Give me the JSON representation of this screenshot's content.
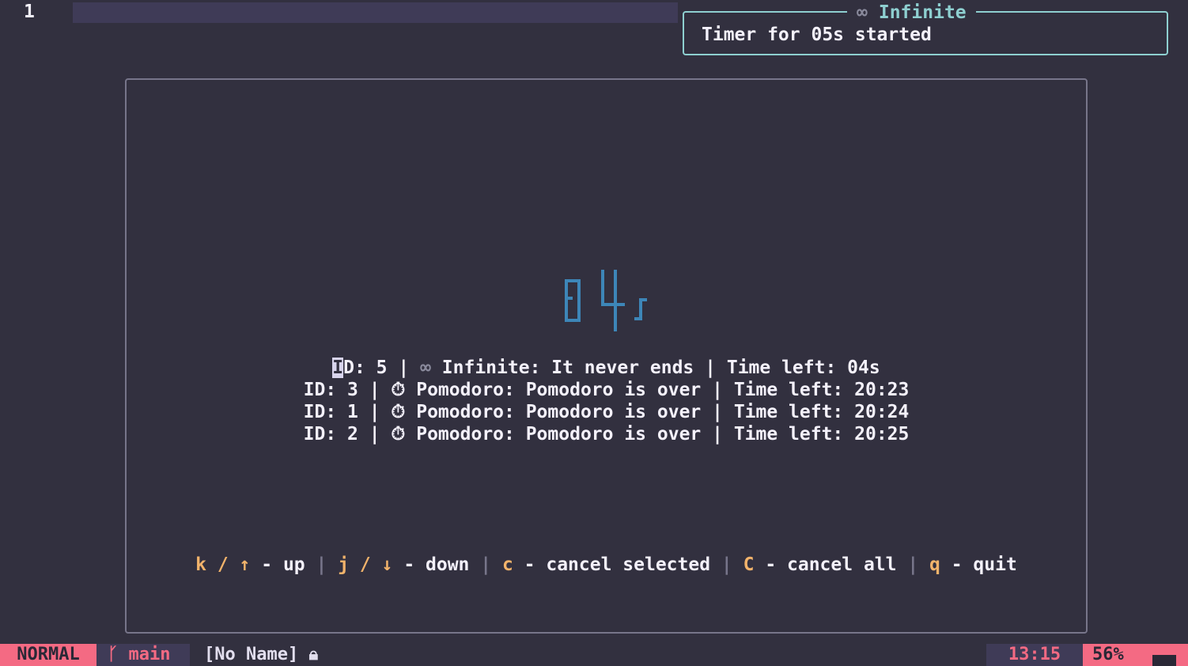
{
  "editor": {
    "line_number": "1"
  },
  "notification": {
    "icon": "∞",
    "title": "Infinite",
    "message": "Timer for 05s started"
  },
  "popup": {
    "countdown": "04s",
    "timers": [
      {
        "id_label": "ID: 5",
        "icon": "∞",
        "text": "Infinite: It never ends",
        "time_left": "Time left: 04s",
        "selected": true
      },
      {
        "id_label": "ID: 3",
        "icon": "⏱",
        "text": "Pomodoro: Pomodoro is over",
        "time_left": "Time left: 20:23"
      },
      {
        "id_label": "ID: 1",
        "icon": "⏱",
        "text": "Pomodoro: Pomodoro is over",
        "time_left": "Time left: 20:24"
      },
      {
        "id_label": "ID: 2",
        "icon": "⏱",
        "text": "Pomodoro: Pomodoro is over",
        "time_left": "Time left: 20:25"
      }
    ],
    "keymap": [
      {
        "keys": "k / ↑",
        "action": "up"
      },
      {
        "keys": "j / ↓",
        "action": "down"
      },
      {
        "keys": "c",
        "action": "cancel selected"
      },
      {
        "keys": "C",
        "action": "cancel all"
      },
      {
        "keys": "q",
        "action": "quit"
      }
    ]
  },
  "statusline": {
    "mode": "NORMAL",
    "branch_icon": "git-branch-icon",
    "branch": "main",
    "file": "[No Name]",
    "lock_icon": "lock-icon",
    "time": "13:15",
    "percent": "56%"
  }
}
